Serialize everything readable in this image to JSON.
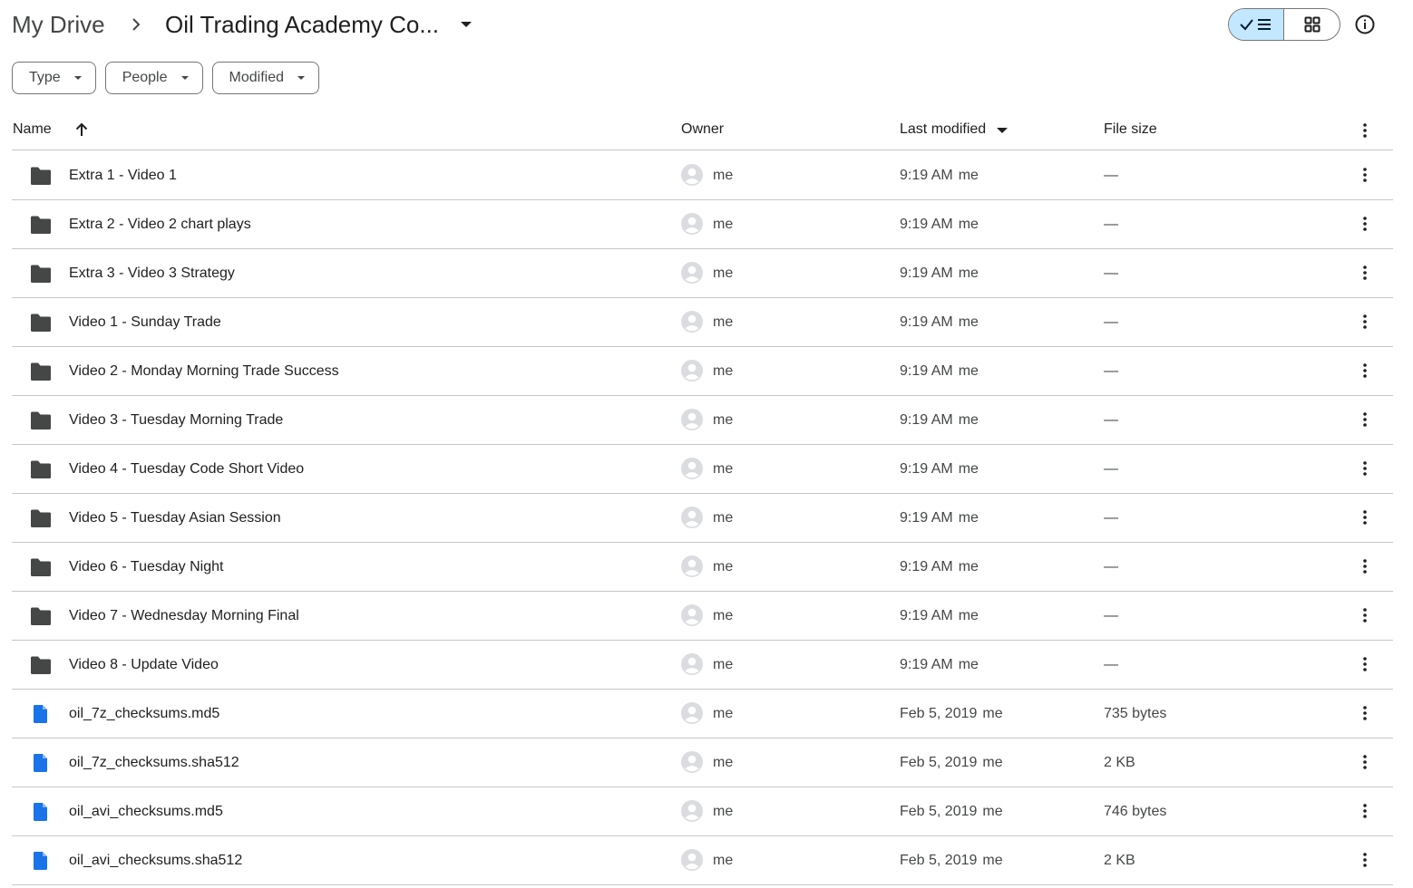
{
  "breadcrumb": {
    "root": "My Drive",
    "current": "Oil Trading Academy Co..."
  },
  "filters": [
    {
      "label": "Type"
    },
    {
      "label": "People"
    },
    {
      "label": "Modified"
    }
  ],
  "columns": {
    "name": "Name",
    "owner": "Owner",
    "last_modified": "Last modified",
    "file_size": "File size"
  },
  "colors": {
    "accent": "#c2e7ff",
    "folder": "#444746",
    "file": "#1a73e8"
  },
  "rows": [
    {
      "icon": "folder-icon",
      "name": "Extra 1 - Video 1",
      "owner": "me",
      "modified": "9:19 AM",
      "modified_by": "me",
      "size": "—"
    },
    {
      "icon": "folder-icon",
      "name": "Extra 2 - Video 2 chart plays",
      "owner": "me",
      "modified": "9:19 AM",
      "modified_by": "me",
      "size": "—"
    },
    {
      "icon": "folder-icon",
      "name": "Extra 3 - Video 3 Strategy",
      "owner": "me",
      "modified": "9:19 AM",
      "modified_by": "me",
      "size": "—"
    },
    {
      "icon": "folder-icon",
      "name": "Video 1 - Sunday Trade",
      "owner": "me",
      "modified": "9:19 AM",
      "modified_by": "me",
      "size": "—"
    },
    {
      "icon": "folder-icon",
      "name": "Video 2 - Monday Morning Trade Success",
      "owner": "me",
      "modified": "9:19 AM",
      "modified_by": "me",
      "size": "—"
    },
    {
      "icon": "folder-icon",
      "name": "Video 3 - Tuesday Morning Trade",
      "owner": "me",
      "modified": "9:19 AM",
      "modified_by": "me",
      "size": "—"
    },
    {
      "icon": "folder-icon",
      "name": "Video 4 - Tuesday Code Short Video",
      "owner": "me",
      "modified": "9:19 AM",
      "modified_by": "me",
      "size": "—"
    },
    {
      "icon": "folder-icon",
      "name": "Video 5 - Tuesday Asian Session",
      "owner": "me",
      "modified": "9:19 AM",
      "modified_by": "me",
      "size": "—"
    },
    {
      "icon": "folder-icon",
      "name": "Video 6 - Tuesday Night",
      "owner": "me",
      "modified": "9:19 AM",
      "modified_by": "me",
      "size": "—"
    },
    {
      "icon": "folder-icon",
      "name": "Video 7 - Wednesday Morning Final",
      "owner": "me",
      "modified": "9:19 AM",
      "modified_by": "me",
      "size": "—"
    },
    {
      "icon": "folder-icon",
      "name": "Video 8 - Update Video",
      "owner": "me",
      "modified": "9:19 AM",
      "modified_by": "me",
      "size": "—"
    },
    {
      "icon": "file-icon",
      "name": "oil_7z_checksums.md5",
      "owner": "me",
      "modified": "Feb 5, 2019",
      "modified_by": "me",
      "size": "735 bytes"
    },
    {
      "icon": "file-icon",
      "name": "oil_7z_checksums.sha512",
      "owner": "me",
      "modified": "Feb 5, 2019",
      "modified_by": "me",
      "size": "2 KB"
    },
    {
      "icon": "file-icon",
      "name": "oil_avi_checksums.md5",
      "owner": "me",
      "modified": "Feb 5, 2019",
      "modified_by": "me",
      "size": "746 bytes"
    },
    {
      "icon": "file-icon",
      "name": "oil_avi_checksums.sha512",
      "owner": "me",
      "modified": "Feb 5, 2019",
      "modified_by": "me",
      "size": "2 KB"
    }
  ]
}
